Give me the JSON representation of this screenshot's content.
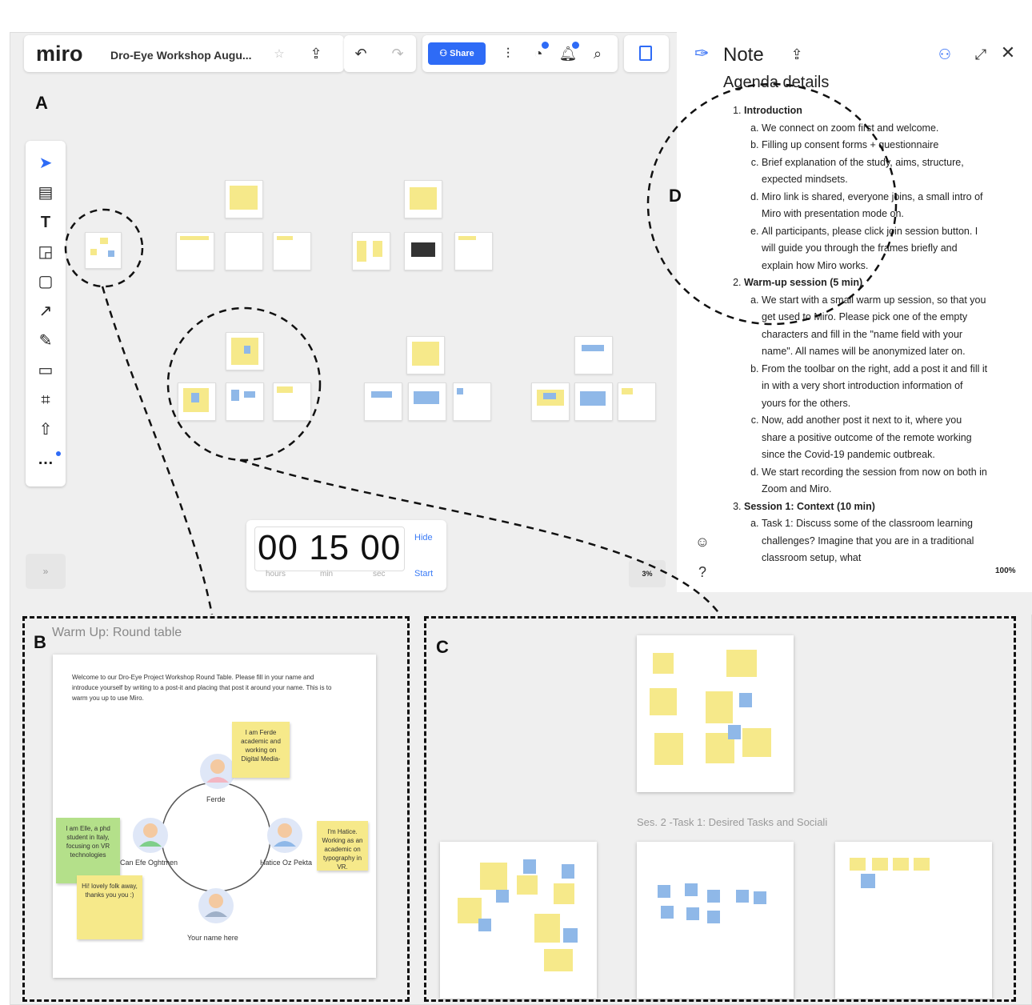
{
  "app": {
    "logo": "miro",
    "board_title": "Dro-Eye Workshop Augu...",
    "share_label": "Share"
  },
  "figure_labels": {
    "a": "A",
    "b": "B",
    "c": "C",
    "d": "D"
  },
  "timer": {
    "hours": "00",
    "minutes": "15",
    "seconds": "00",
    "hours_unit": "hours",
    "min_unit": "min",
    "sec_unit": "sec",
    "hide_label": "Hide",
    "start_label": "Start"
  },
  "zoom": {
    "board_zoom": "3%",
    "note_zoom": "100%"
  },
  "note_panel": {
    "title": "Note",
    "heading": "Agenda details",
    "sections": [
      {
        "title": "Introduction",
        "items": [
          "We connect on zoom first and welcome.",
          "Filling up consent forms + questionnaire",
          "Brief explanation of the study, aims, structure, expected mindsets.",
          "Miro link is shared, everyone joins, a small intro of Miro with presentation mode on.",
          "All participants, please click join session button. I will guide you through the frames briefly and explain how Miro works."
        ]
      },
      {
        "title": "Warm-up session (5 min)",
        "items": [
          "We start with a small warm up session, so that you get used to Miro. Please pick one of the empty characters and fill in the \"name field with your name\". All names will be anonymized later on.",
          "From the toolbar on the right, add a post it and fill it in with a very short introduction information of yours for the others.",
          "Now, add another post it next to it, where you share a positive outcome of the remote working since the Covid-19 pandemic outbreak.",
          "We start recording the session from now on both in Zoom and Miro."
        ]
      },
      {
        "title": "Session 1: Context (10 min)",
        "items": [
          "Task 1: Discuss some of the classroom learning challenges? Imagine that you are in a traditional classroom setup, what"
        ]
      }
    ]
  },
  "pane_b": {
    "title": "Warm Up: Round table",
    "intro": "Welcome to our Dro-Eye Project Workshop Round Table. Please fill in your name and introduce yourself by writing to a post-it and placing that post it around your name. This is to warm you up to use Miro.",
    "stickies": [
      "I am Ferde academic and working on Digital Media-",
      "I am Elle, a phd student in Italy, focusing on VR technologies",
      "I'm Hatice. Working as an academic on typography in VR.",
      "Hi! lovely folk away, thanks you you :)"
    ],
    "people": [
      "Ferde",
      "Can Efe Oghtmen",
      "Hatice Oz Pekta",
      "Your name here"
    ]
  },
  "pane_c": {
    "title": "Ses. 2 -Task 1: Desired Tasks and Sociali"
  },
  "colors": {
    "accent": "#2e6bf6",
    "sticky_yellow": "#f6e98a",
    "sticky_green": "#b4e08a",
    "sticky_blue": "#8fb8e8"
  }
}
